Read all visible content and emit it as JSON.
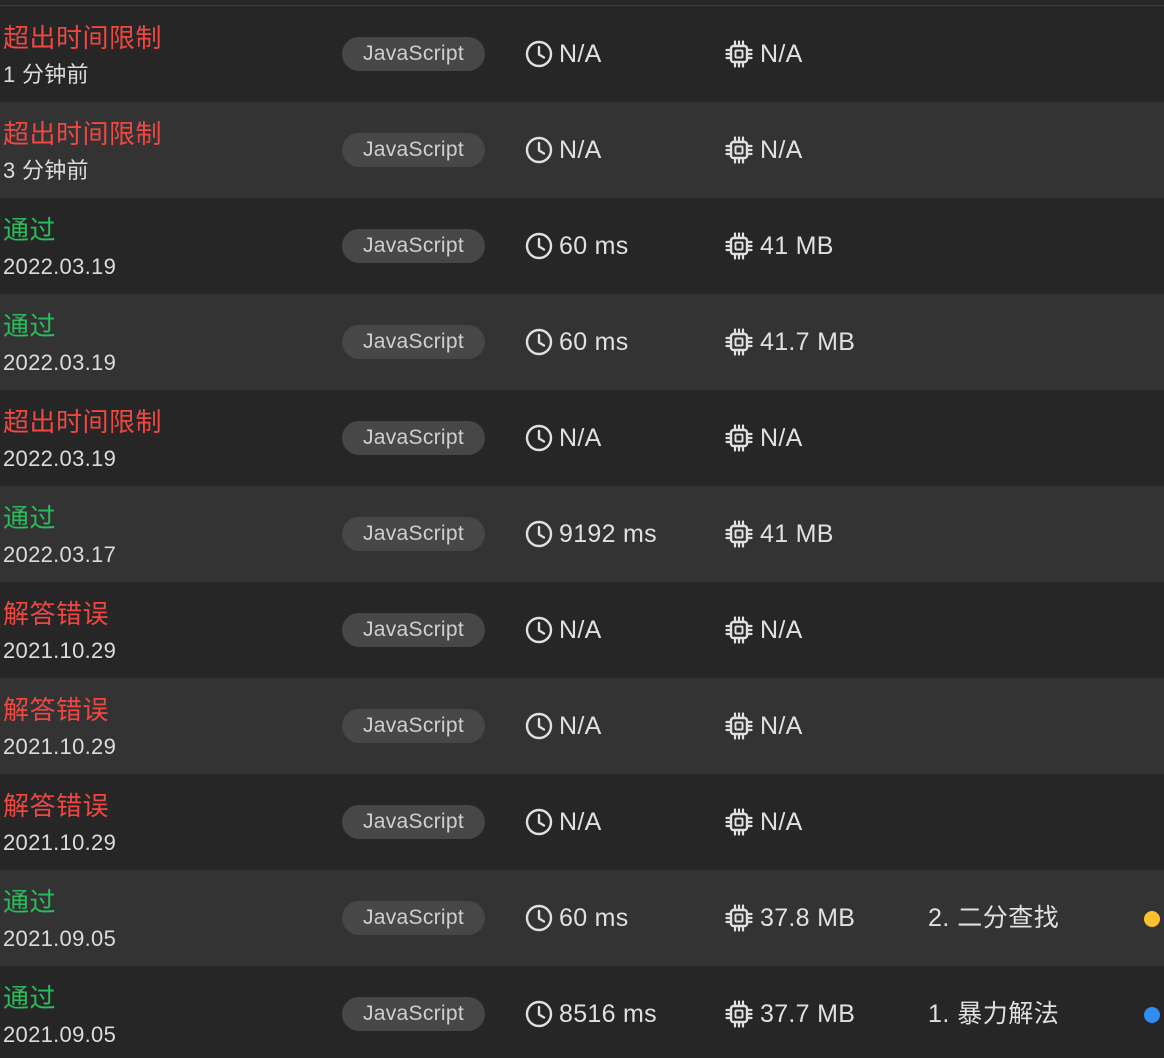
{
  "submissions": [
    {
      "status": "超出时间限制",
      "status_type": "bad",
      "time": "1 分钟前",
      "language": "JavaScript",
      "runtime": "N/A",
      "memory": "N/A",
      "note": "",
      "dot_color": ""
    },
    {
      "status": "超出时间限制",
      "status_type": "bad",
      "time": "3 分钟前",
      "language": "JavaScript",
      "runtime": "N/A",
      "memory": "N/A",
      "note": "",
      "dot_color": ""
    },
    {
      "status": "通过",
      "status_type": "ok",
      "time": "2022.03.19",
      "language": "JavaScript",
      "runtime": "60 ms",
      "memory": "41 MB",
      "note": "",
      "dot_color": ""
    },
    {
      "status": "通过",
      "status_type": "ok",
      "time": "2022.03.19",
      "language": "JavaScript",
      "runtime": "60 ms",
      "memory": "41.7 MB",
      "note": "",
      "dot_color": ""
    },
    {
      "status": "超出时间限制",
      "status_type": "bad",
      "time": "2022.03.19",
      "language": "JavaScript",
      "runtime": "N/A",
      "memory": "N/A",
      "note": "",
      "dot_color": ""
    },
    {
      "status": "通过",
      "status_type": "ok",
      "time": "2022.03.17",
      "language": "JavaScript",
      "runtime": "9192 ms",
      "memory": "41 MB",
      "note": "",
      "dot_color": ""
    },
    {
      "status": "解答错误",
      "status_type": "bad",
      "time": "2021.10.29",
      "language": "JavaScript",
      "runtime": "N/A",
      "memory": "N/A",
      "note": "",
      "dot_color": ""
    },
    {
      "status": "解答错误",
      "status_type": "bad",
      "time": "2021.10.29",
      "language": "JavaScript",
      "runtime": "N/A",
      "memory": "N/A",
      "note": "",
      "dot_color": ""
    },
    {
      "status": "解答错误",
      "status_type": "bad",
      "time": "2021.10.29",
      "language": "JavaScript",
      "runtime": "N/A",
      "memory": "N/A",
      "note": "",
      "dot_color": ""
    },
    {
      "status": "通过",
      "status_type": "ok",
      "time": "2021.09.05",
      "language": "JavaScript",
      "runtime": "60 ms",
      "memory": "37.8 MB",
      "note": "2. 二分查找",
      "dot_color": "#fbc02d"
    },
    {
      "status": "通过",
      "status_type": "ok",
      "time": "2021.09.05",
      "language": "JavaScript",
      "runtime": "8516 ms",
      "memory": "37.7 MB",
      "note": "1. 暴力解法",
      "dot_color": "#2f8cf0"
    }
  ],
  "icons": {
    "runtime": "clock-icon",
    "memory": "chip-icon"
  },
  "colors": {
    "accepted": "#2cbb5d",
    "error": "#ef4743",
    "row_dark": "#262626",
    "row_light": "#333333"
  }
}
